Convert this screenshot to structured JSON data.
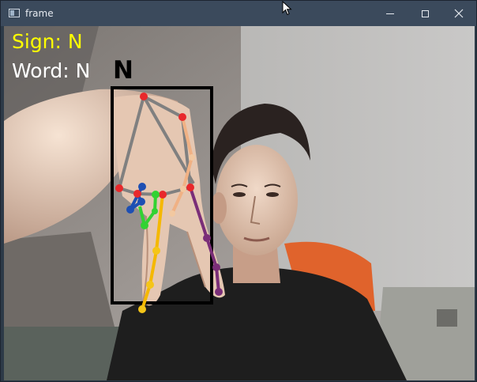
{
  "window": {
    "title": "frame",
    "controls": {
      "minimize": "minimize",
      "maximize": "maximize",
      "close": "close"
    }
  },
  "overlay": {
    "sign_text": "Sign: N",
    "word_text": "Word: N",
    "current_letter": "N"
  },
  "colors": {
    "sign": "#ffff00",
    "word": "#ffffff",
    "bounding_box": "#000000",
    "landmark_red": "#e8282b",
    "thumb": "#f2c8a0",
    "index": "#f5c518",
    "middle": "#f0c000",
    "ring": "#2fd63a",
    "pinky": "#1e4fb3",
    "palm": "#808080",
    "little_finger": "#7a2e78"
  }
}
